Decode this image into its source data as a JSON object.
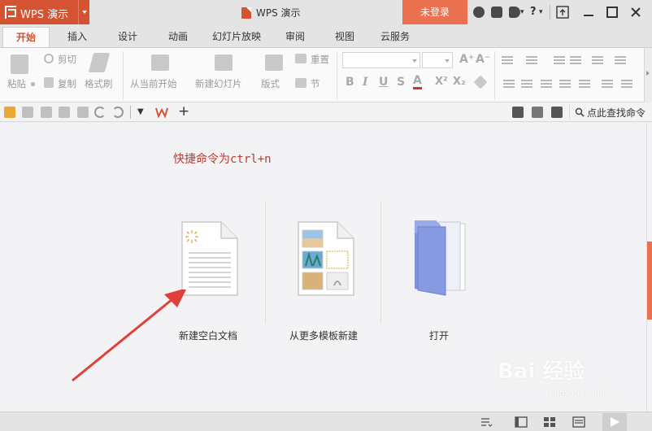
{
  "titlebar": {
    "app_menu": "WPS 演示",
    "window_title": "WPS 演示",
    "login_button": "未登录",
    "help_glyph": "?"
  },
  "tabs": [
    "开始",
    "插入",
    "设计",
    "动画",
    "幻灯片放映",
    "审阅",
    "视图",
    "云服务"
  ],
  "active_tab": "开始",
  "ribbon": {
    "paste": "粘贴",
    "cut": "剪切",
    "copy": "复制",
    "format_painter": "格式刷",
    "from_current": "从当前开始",
    "new_slide": "新建幻灯片",
    "layout": "版式",
    "reset": "重置",
    "section": "节",
    "bold": "B",
    "italic": "I",
    "underline": "U",
    "strike": "S",
    "font_color": "A",
    "superscript": "X²",
    "subscript": "X₂",
    "grow": "A⁺",
    "shrink": "A⁻"
  },
  "quickbar": {
    "find_command": "点此查找命令"
  },
  "main": {
    "hint": "快捷命令为ctrl+n",
    "new_blank": "新建空白文档",
    "from_template": "从更多模板新建",
    "open": "打开"
  },
  "watermark": {
    "brand": "Bai 经验",
    "url": "jingyan.baidu.com"
  },
  "colors": {
    "accent": "#d35332",
    "login": "#e9714f",
    "hint_text": "#c0392b",
    "arrow": "#e0403a",
    "folder": "#7f93de"
  },
  "icons": [
    "wps-logo-icon",
    "document-icon",
    "skin-icon",
    "cube-icon",
    "cloud-icon",
    "help-icon",
    "restore-icon",
    "minimize-icon",
    "maximize-icon",
    "close-icon",
    "search-icon",
    "play-icon"
  ]
}
